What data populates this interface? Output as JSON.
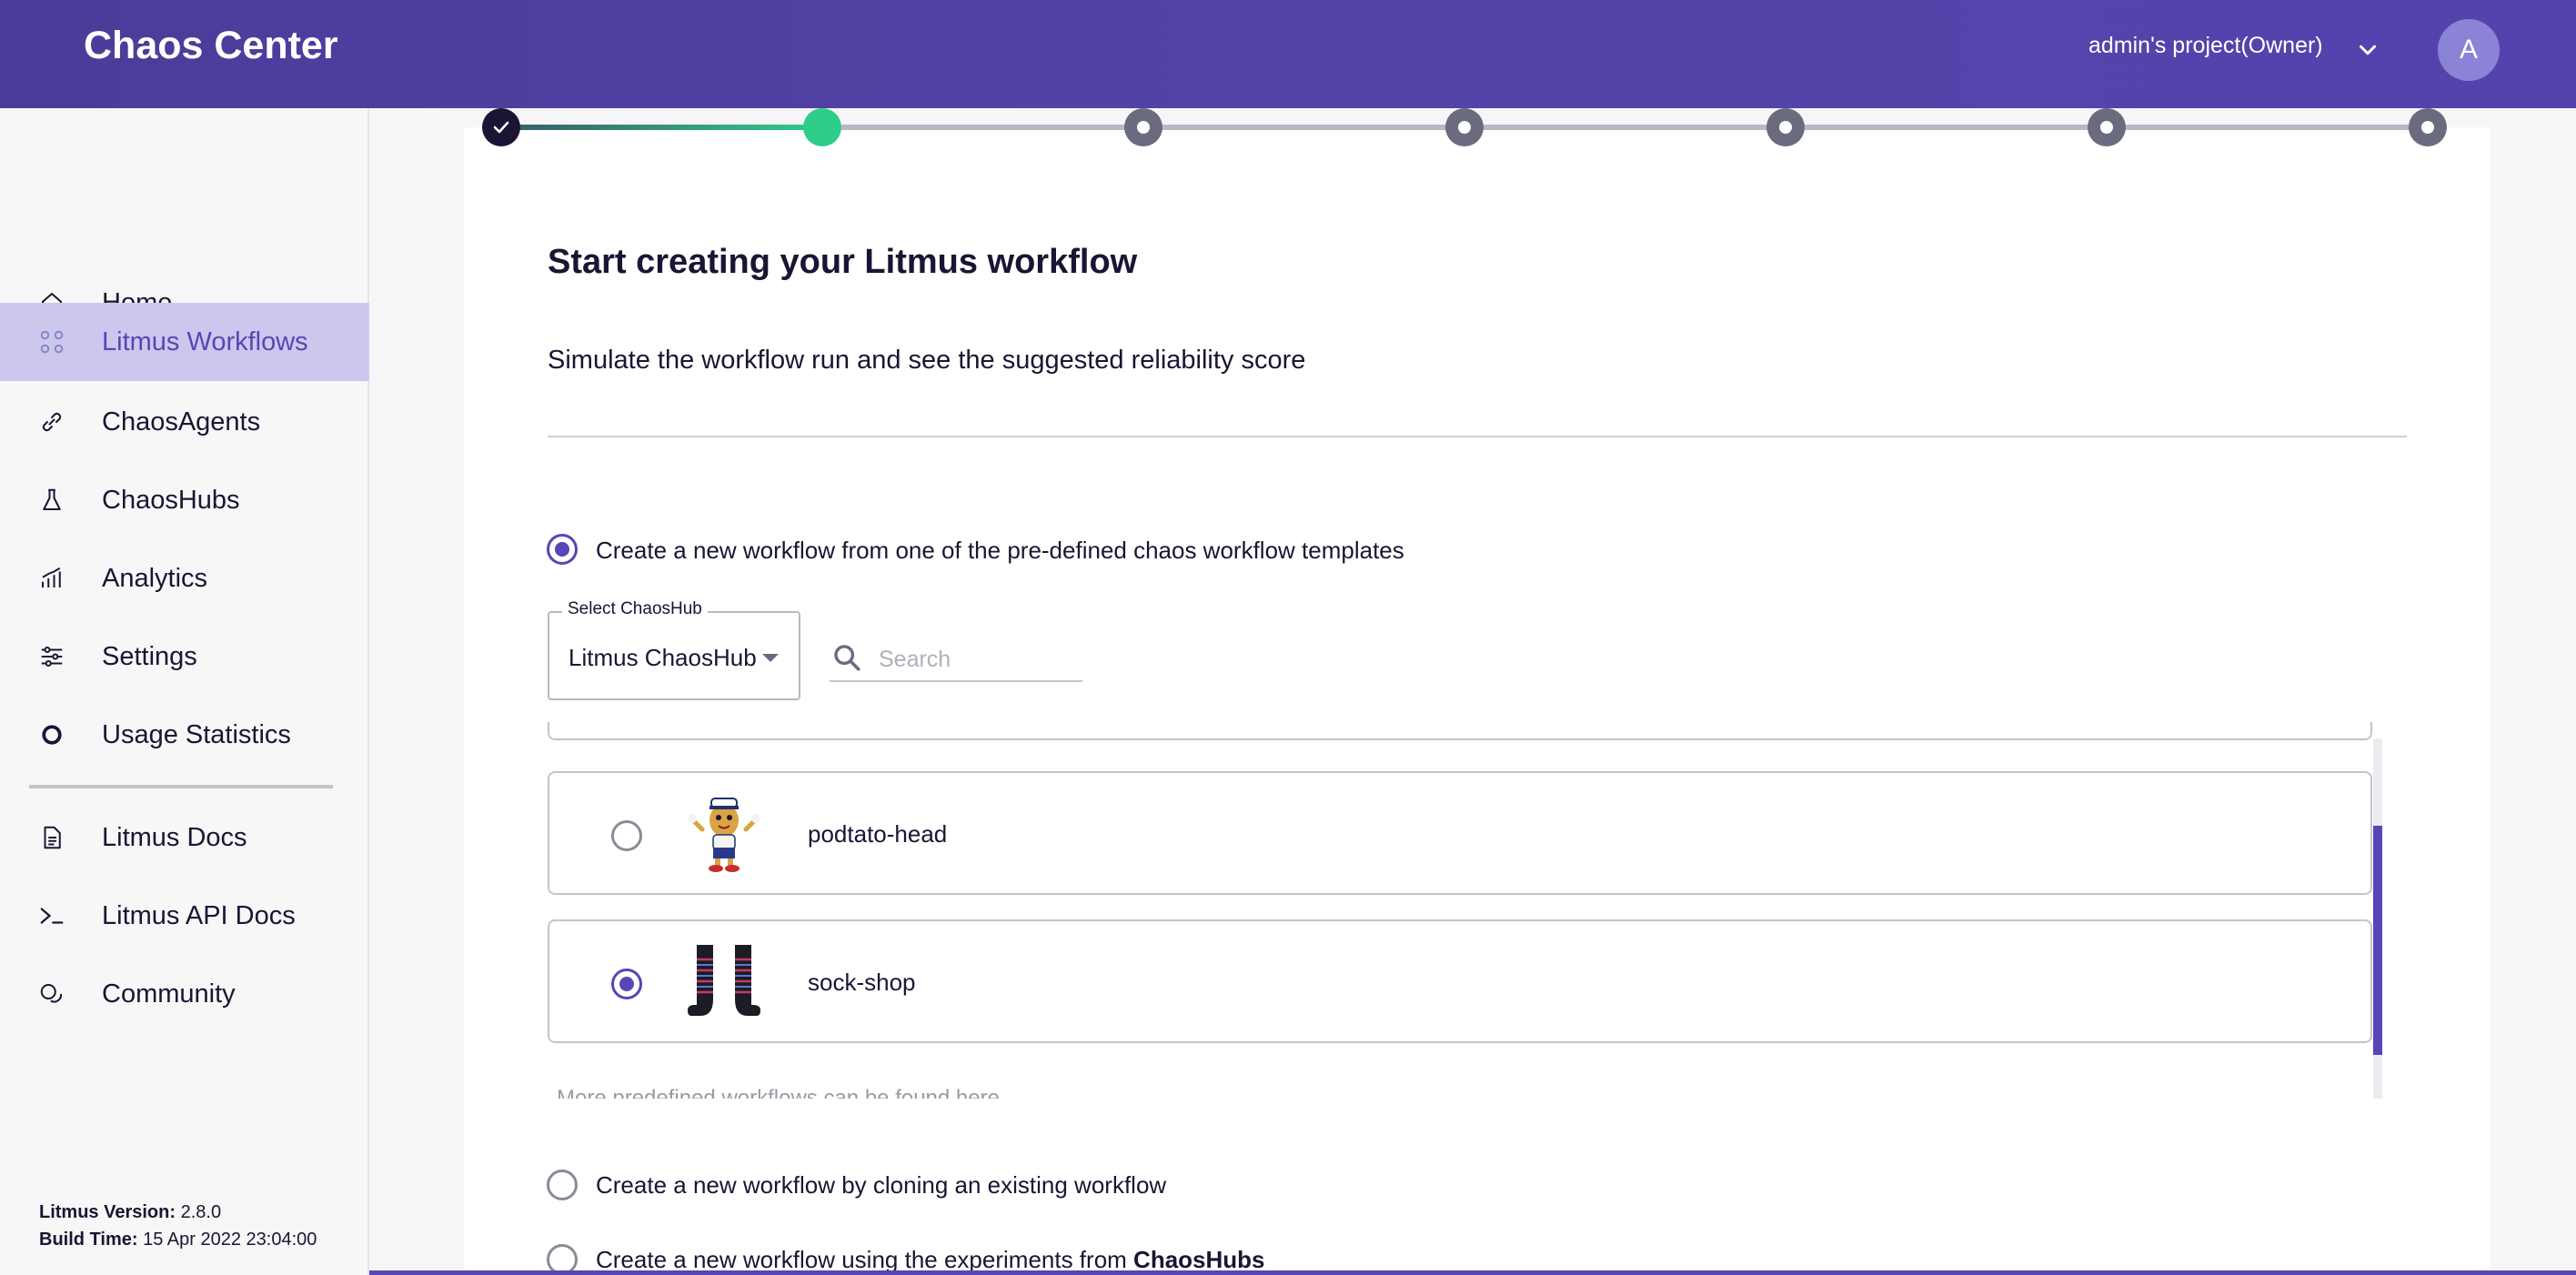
{
  "header": {
    "brand": "Chaos Center",
    "project": "admin's project(Owner)",
    "avatar_letter": "A"
  },
  "sidebar": {
    "items": [
      {
        "label": "Home",
        "icon": "home-icon"
      },
      {
        "label": "Litmus Workflows",
        "icon": "workflows-icon",
        "active": true
      },
      {
        "label": "ChaosAgents",
        "icon": "link-icon"
      },
      {
        "label": "ChaosHubs",
        "icon": "flask-icon"
      },
      {
        "label": "Analytics",
        "icon": "analytics-icon"
      },
      {
        "label": "Settings",
        "icon": "sliders-icon"
      },
      {
        "label": "Usage Statistics",
        "icon": "donut-icon"
      }
    ],
    "secondary_items": [
      {
        "label": "Litmus Docs",
        "icon": "document-icon"
      },
      {
        "label": "Litmus API Docs",
        "icon": "terminal-icon"
      },
      {
        "label": "Community",
        "icon": "chat-icon"
      }
    ],
    "version_label": "Litmus Version:",
    "version_value": "2.8.0",
    "build_label": "Build Time:",
    "build_value": "15 Apr 2022 23:04:00"
  },
  "stepper": {
    "total_steps": 7,
    "completed_steps": 1,
    "current_step": 2,
    "colors": {
      "done": "#1c1433",
      "current": "#2fcd8a",
      "pending": "#6b6b80"
    }
  },
  "main": {
    "title": "Start creating your Litmus workflow",
    "subtitle": "Simulate the workflow run and see the suggested reliability score",
    "option_predefined": "Create a new workflow from one of the pre-defined chaos workflow templates",
    "select_label": "Select ChaosHub",
    "select_value": "Litmus ChaosHub",
    "search_placeholder": "Search",
    "templates": [
      {
        "name": "podtato-head",
        "selected": false
      },
      {
        "name": "sock-shop",
        "selected": true
      }
    ],
    "faded_text": "More predefined workflows can be found here",
    "option_clone": "Create a new workflow by cloning an existing workflow",
    "option_experiments_prefix": "Create a new workflow using the experiments from",
    "option_experiments_bold": "ChaosHubs"
  },
  "colors": {
    "accent": "#5845b6",
    "header": "#5244a8",
    "active_nav": "#ccc8ed"
  }
}
